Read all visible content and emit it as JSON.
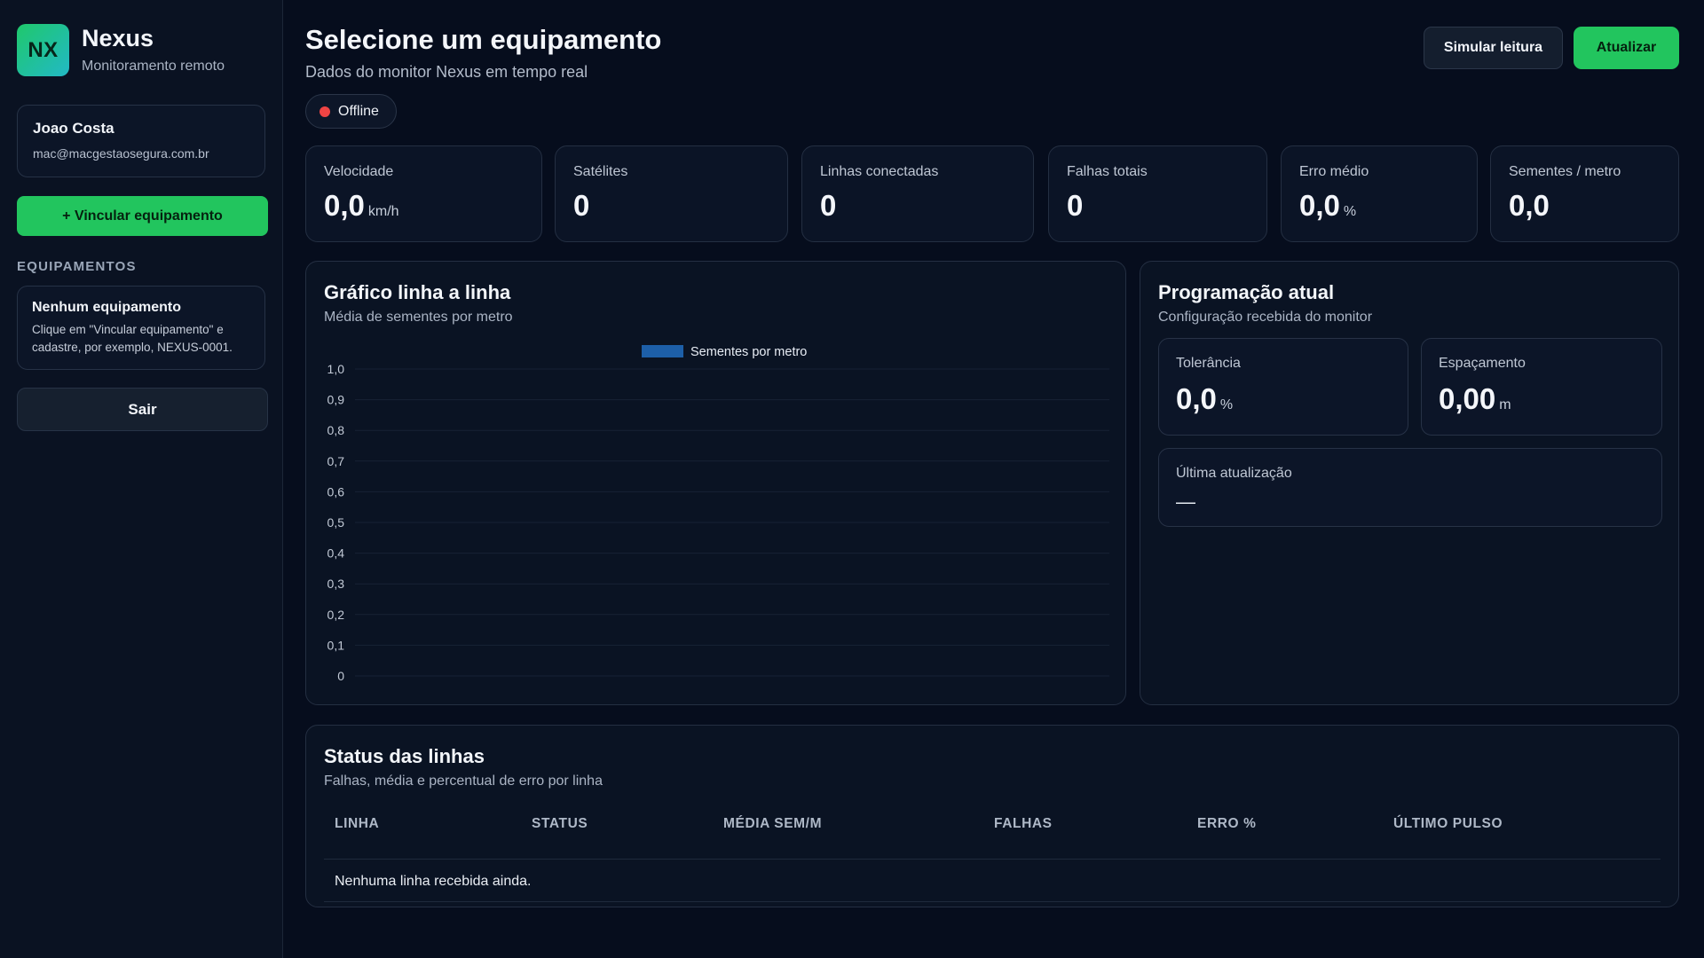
{
  "brand": {
    "logo_text": "NX",
    "name": "Nexus",
    "subtitle": "Monitoramento remoto"
  },
  "user": {
    "name": "Joao Costa",
    "email": "mac@macgestaosegura.com.br"
  },
  "sidebar": {
    "link_button": "+ Vincular equipamento",
    "section_label": "EQUIPAMENTOS",
    "empty_title": "Nenhum equipamento",
    "empty_text": "Clique em \"Vincular equipamento\" e cadastre, por exemplo, NEXUS-0001.",
    "logout_button": "Sair"
  },
  "header": {
    "title": "Selecione um equipamento",
    "subtitle": "Dados do monitor Nexus em tempo real",
    "status": "Offline",
    "simulate_button": "Simular leitura",
    "refresh_button": "Atualizar"
  },
  "stats": [
    {
      "label": "Velocidade",
      "value": "0,0",
      "unit": "km/h"
    },
    {
      "label": "Satélites",
      "value": "0",
      "unit": ""
    },
    {
      "label": "Linhas conectadas",
      "value": "0",
      "unit": ""
    },
    {
      "label": "Falhas totais",
      "value": "0",
      "unit": ""
    },
    {
      "label": "Erro médio",
      "value": "0,0",
      "unit": "%"
    },
    {
      "label": "Sementes / metro",
      "value": "0,0",
      "unit": ""
    }
  ],
  "chart_panel": {
    "title": "Gráfico linha a linha",
    "subtitle": "Média de sementes por metro"
  },
  "chart_data": {
    "type": "bar",
    "categories": [],
    "series": [
      {
        "name": "Sementes por metro",
        "values": []
      }
    ],
    "y_ticks": [
      "0",
      "0,1",
      "0,2",
      "0,3",
      "0,4",
      "0,5",
      "0,6",
      "0,7",
      "0,8",
      "0,9",
      "1,0"
    ],
    "ylim": [
      0,
      1
    ],
    "grid": true,
    "legend": "top-center",
    "series_color": "#1d5fa8"
  },
  "programacao": {
    "title": "Programação atual",
    "subtitle": "Configuração recebida do monitor",
    "tolerancia_label": "Tolerância",
    "tolerancia_value": "0,0",
    "tolerancia_unit": "%",
    "espacamento_label": "Espaçamento",
    "espacamento_value": "0,00",
    "espacamento_unit": "m",
    "ultima_label": "Última atualização",
    "ultima_value": "—"
  },
  "lines_status": {
    "title": "Status das linhas",
    "subtitle": "Falhas, média e percentual de erro por linha",
    "columns": [
      "LINHA",
      "STATUS",
      "MÉDIA SEM/M",
      "FALHAS",
      "ERRO %",
      "ÚLTIMO PULSO"
    ],
    "empty_message": "Nenhuma linha recebida ainda."
  },
  "colors": {
    "accent": "#22c55e",
    "offline": "#ef4444",
    "background": "#060d1d"
  }
}
